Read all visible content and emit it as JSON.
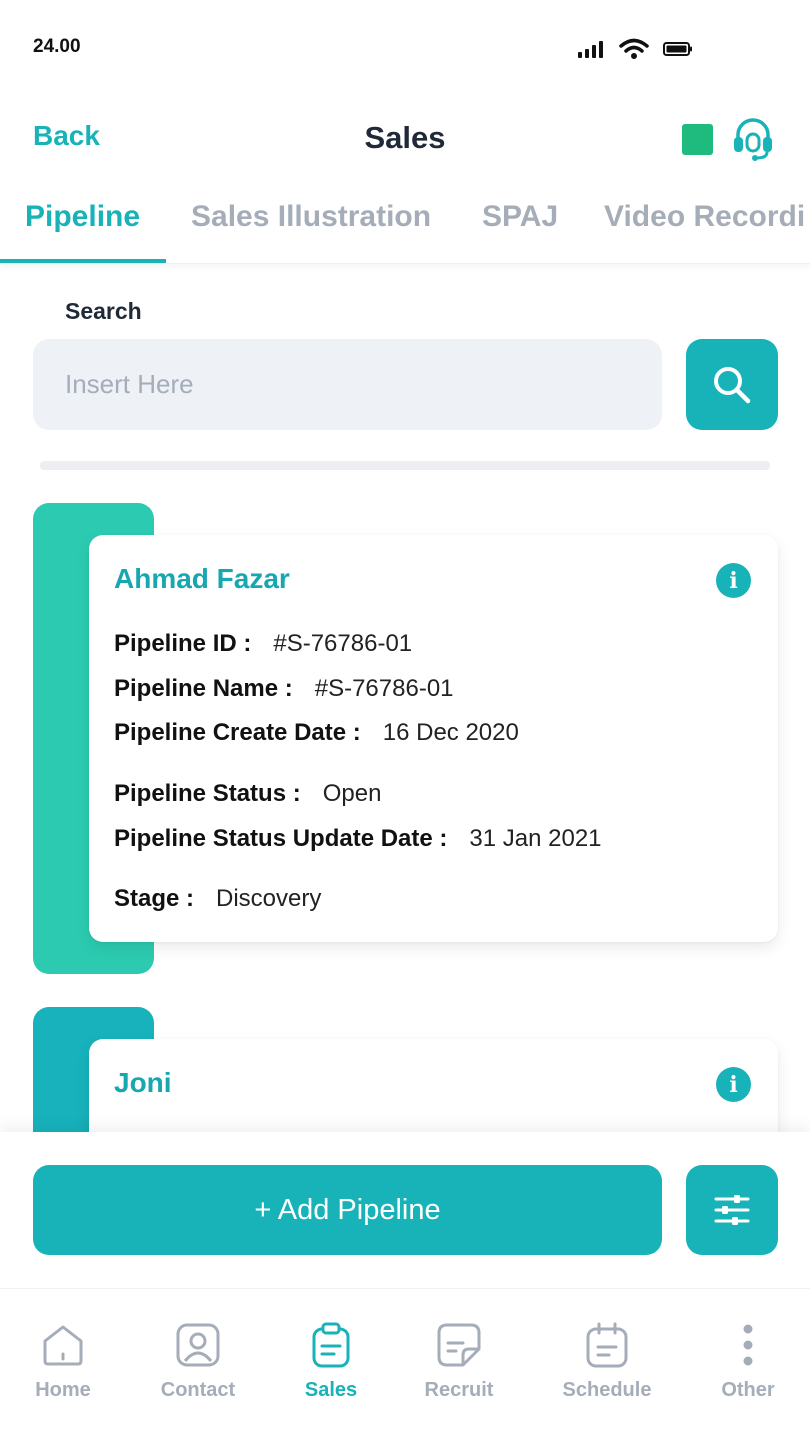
{
  "status_bar": {
    "time": "24.00"
  },
  "header": {
    "back_label": "Back",
    "title": "Sales"
  },
  "tabs": [
    {
      "label": "Pipeline",
      "active": true
    },
    {
      "label": "Sales Illustration",
      "active": false
    },
    {
      "label": "SPAJ",
      "active": false
    },
    {
      "label": "Video Recordi",
      "active": false
    }
  ],
  "search": {
    "label": "Search",
    "placeholder": "Insert Here"
  },
  "pipelines": [
    {
      "name": "Ahmad Fazar",
      "accent_color": "#2ccbb1",
      "fields": [
        {
          "label": "Pipeline ID :",
          "value": "#S-76786-01"
        },
        {
          "label": "Pipeline Name :",
          "value": "#S-76786-01"
        },
        {
          "label": "Pipeline Create Date :",
          "value": "16 Dec 2020"
        },
        {
          "label": "Pipeline Status :",
          "value": "Open"
        },
        {
          "label": "Pipeline Status Update Date :",
          "value": "31 Jan 2021"
        },
        {
          "label": "Stage :",
          "value": "Discovery"
        }
      ]
    },
    {
      "name": "Joni",
      "accent_color": "#18b2bc"
    }
  ],
  "actions": {
    "add_label": "+ Add Pipeline"
  },
  "bottom_nav": [
    {
      "label": "Home",
      "icon": "home-icon",
      "active": false
    },
    {
      "label": "Contact",
      "icon": "contact-icon",
      "active": false
    },
    {
      "label": "Sales",
      "icon": "sales-clipboard-icon",
      "active": true
    },
    {
      "label": "Recruit",
      "icon": "recruit-note-icon",
      "active": false
    },
    {
      "label": "Schedule",
      "icon": "calendar-icon",
      "active": false
    },
    {
      "label": "Other",
      "icon": "more-vertical-icon",
      "active": false
    }
  ],
  "colors": {
    "accent": "#17b3b9",
    "status_green": "#1fba7e",
    "muted": "#a4adb8"
  }
}
